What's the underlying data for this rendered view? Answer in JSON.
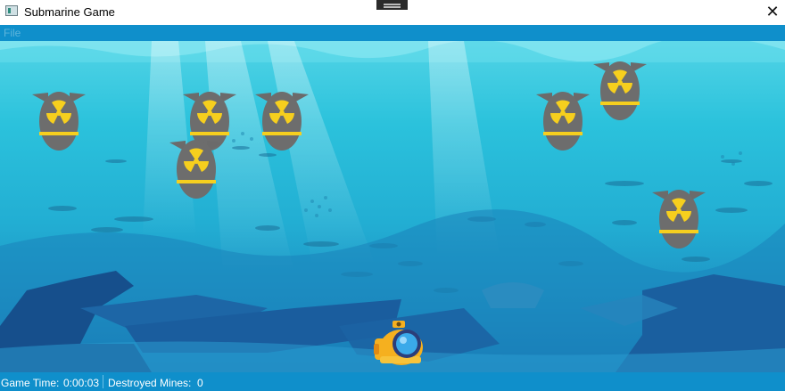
{
  "window": {
    "title": "Submarine Game",
    "close_glyph": "✕",
    "app_icon": "window-app-icon"
  },
  "menu": {
    "items": [
      {
        "label": "File"
      }
    ]
  },
  "game": {
    "mines": [
      {
        "id": 1,
        "icon": "radioactive-mine-icon"
      },
      {
        "id": 2,
        "icon": "radioactive-mine-icon"
      },
      {
        "id": 3,
        "icon": "radioactive-mine-icon"
      },
      {
        "id": 4,
        "icon": "radioactive-mine-icon"
      },
      {
        "id": 5,
        "icon": "radioactive-mine-icon"
      },
      {
        "id": 6,
        "icon": "radioactive-mine-icon"
      },
      {
        "id": 7,
        "icon": "radioactive-mine-icon"
      }
    ],
    "player": {
      "icon": "submarine-icon"
    },
    "colors": {
      "mine_body": "#6d6d6d",
      "mine_band": "#f6cf1e",
      "hazard": "#f6cf1e",
      "sub": "#f5b01f",
      "sub_glass": "#3aa9e9"
    }
  },
  "status": {
    "game_time_label": "Game Time:",
    "game_time_value": "0:00:03",
    "destroyed_label": "Destroyed Mines:",
    "destroyed_value": "0"
  }
}
